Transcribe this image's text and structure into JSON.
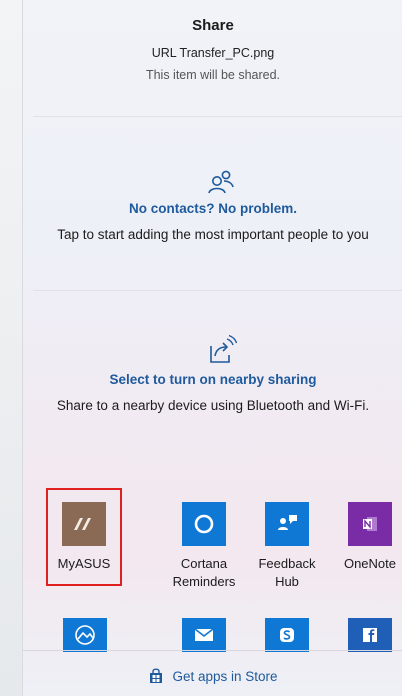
{
  "share": {
    "title": "Share",
    "file_name": "URL Transfer_PC.png",
    "note": "This item will be shared."
  },
  "contacts": {
    "icon": "people-icon",
    "title": "No contacts? No problem.",
    "description": "Tap to start adding the most important people to you"
  },
  "nearby": {
    "icon": "nearby-share-icon",
    "title": "Select to turn on nearby sharing",
    "description": "Share to a nearby device using Bluetooth and Wi-Fi."
  },
  "apps": [
    {
      "label": "MyASUS",
      "icon": "myasus-icon",
      "color": "#8a6a55",
      "selected": true
    },
    {
      "label": "Cortana Reminders",
      "icon": "cortana-icon",
      "color": "#0f78d4"
    },
    {
      "label": "Feedback Hub",
      "icon": "feedback-hub-icon",
      "color": "#0f78d4"
    },
    {
      "label": "OneNote",
      "icon": "onenote-icon",
      "color": "#7a2ca6"
    }
  ],
  "apps_row2": [
    {
      "icon": "photos-icon",
      "color": "#0f78d4"
    },
    {
      "icon": "mail-icon",
      "color": "#0f78d4"
    },
    {
      "icon": "skype-icon",
      "color": "#0f78d4"
    },
    {
      "icon": "facebook-icon",
      "color": "#1f5fb8"
    }
  ],
  "footer": {
    "icon": "store-icon",
    "label": "Get apps in Store"
  }
}
